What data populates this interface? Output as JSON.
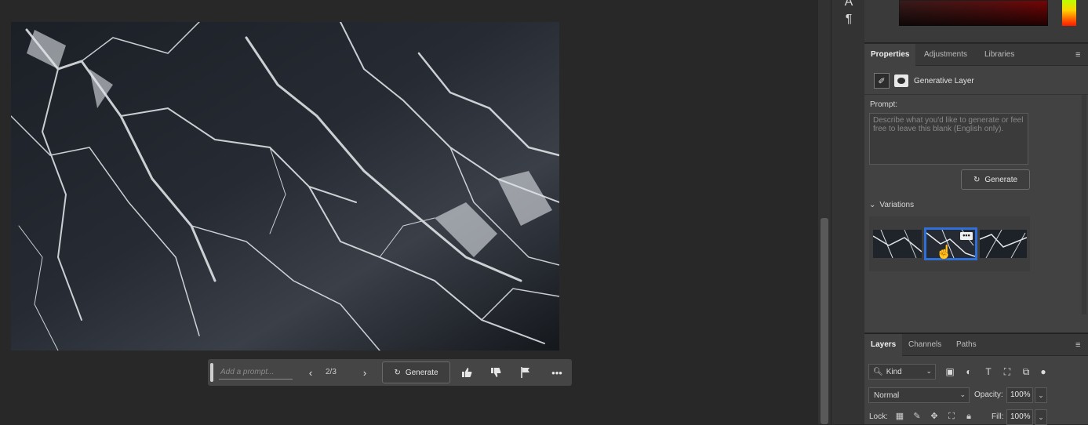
{
  "canvas": {
    "image_alt": "dark marble with white veins"
  },
  "taskbar": {
    "prompt_placeholder": "Add a prompt...",
    "counter": "2/3",
    "generate_label": "Generate",
    "icons": [
      "chevron-left-icon",
      "chevron-right-icon",
      "generate-icon",
      "thumbs-up-icon",
      "thumbs-down-icon",
      "flag-icon",
      "more-icon"
    ]
  },
  "tools": {
    "items": [
      "type-icon",
      "paragraph-icon"
    ]
  },
  "properties": {
    "tabs": [
      {
        "label": "Properties",
        "active": true
      },
      {
        "label": "Adjustments",
        "active": false
      },
      {
        "label": "Libraries",
        "active": false
      }
    ],
    "layer_type": "Generative Layer",
    "prompt_label": "Prompt:",
    "prompt_placeholder": "Describe what you'd like to generate or feel free to leave this blank (English only).",
    "generate_label": "Generate",
    "variations_label": "Variations",
    "variations_count": 3,
    "selected_variation": 2,
    "more_label": "•••"
  },
  "layers": {
    "tabs": [
      {
        "label": "Layers",
        "active": true
      },
      {
        "label": "Channels",
        "active": false
      },
      {
        "label": "Paths",
        "active": false
      }
    ],
    "kind_label": "Kind",
    "blend_mode": "Normal",
    "opacity_label": "Opacity:",
    "opacity_value": "100%",
    "lock_label": "Lock:",
    "fill_label": "Fill:",
    "fill_value": "100%"
  },
  "colors": {
    "accent_selected": "#2f6fd6",
    "panel_bg": "#424242",
    "canvas_bg": "#282828"
  }
}
